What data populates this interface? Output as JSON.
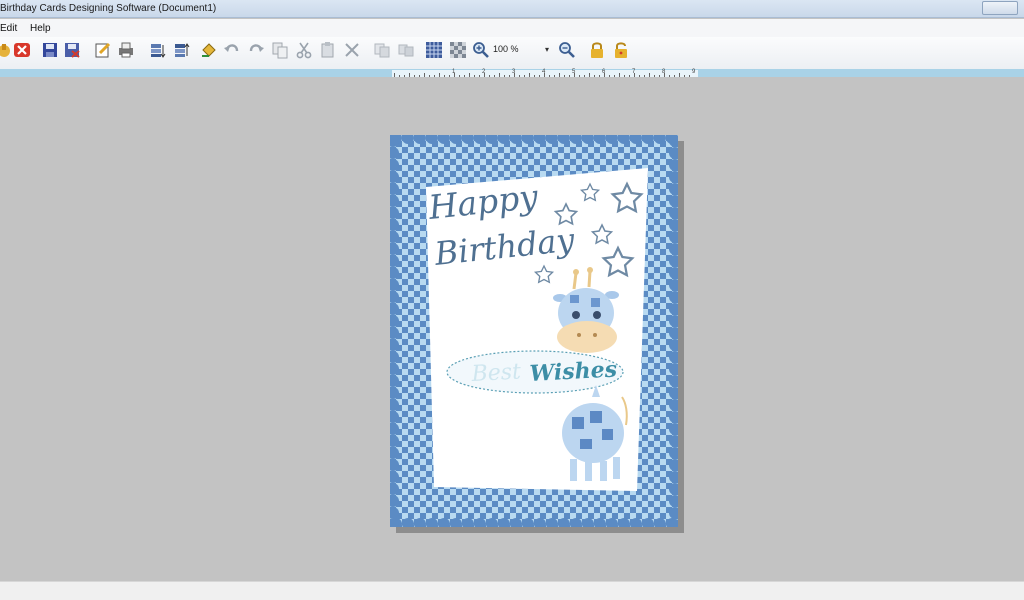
{
  "window": {
    "title": "Birthday Cards Designing Software  (Document1)"
  },
  "menu": {
    "items": [
      "Edit",
      "Help"
    ]
  },
  "toolbar": {
    "zoom_value": "100 %",
    "zoom_dropdown_arrow": "▾"
  },
  "ruler": {
    "labels": [
      "1",
      "2",
      "3",
      "4",
      "5",
      "6",
      "7",
      "8",
      "9"
    ]
  },
  "card": {
    "greeting_line1": "Happy",
    "greeting_line2": "Birthday",
    "wishes_first": "Best",
    "wishes_second": "Wishes"
  },
  "colors": {
    "checker_dark": "#5b8bc4",
    "checker_light": "#b8daf1",
    "text_dark": "#4f7091",
    "wishes_teal": "#3d8ea6",
    "giraffe_tan": "#f5dcb3"
  },
  "icons": [
    "new-icon",
    "close-doc-icon",
    "save-icon",
    "save-as-icon",
    "edit-icon",
    "print-icon",
    "layer-down-icon",
    "layer-up-icon",
    "fill-icon",
    "undo-icon",
    "redo-icon",
    "copy-icon",
    "cut-icon",
    "paste-icon",
    "delete-icon",
    "duplicate-icon",
    "group-icon",
    "grid-icon",
    "transparent-icon",
    "zoom-in-icon",
    "zoom-out-icon",
    "lock-icon",
    "unlock-icon"
  ]
}
